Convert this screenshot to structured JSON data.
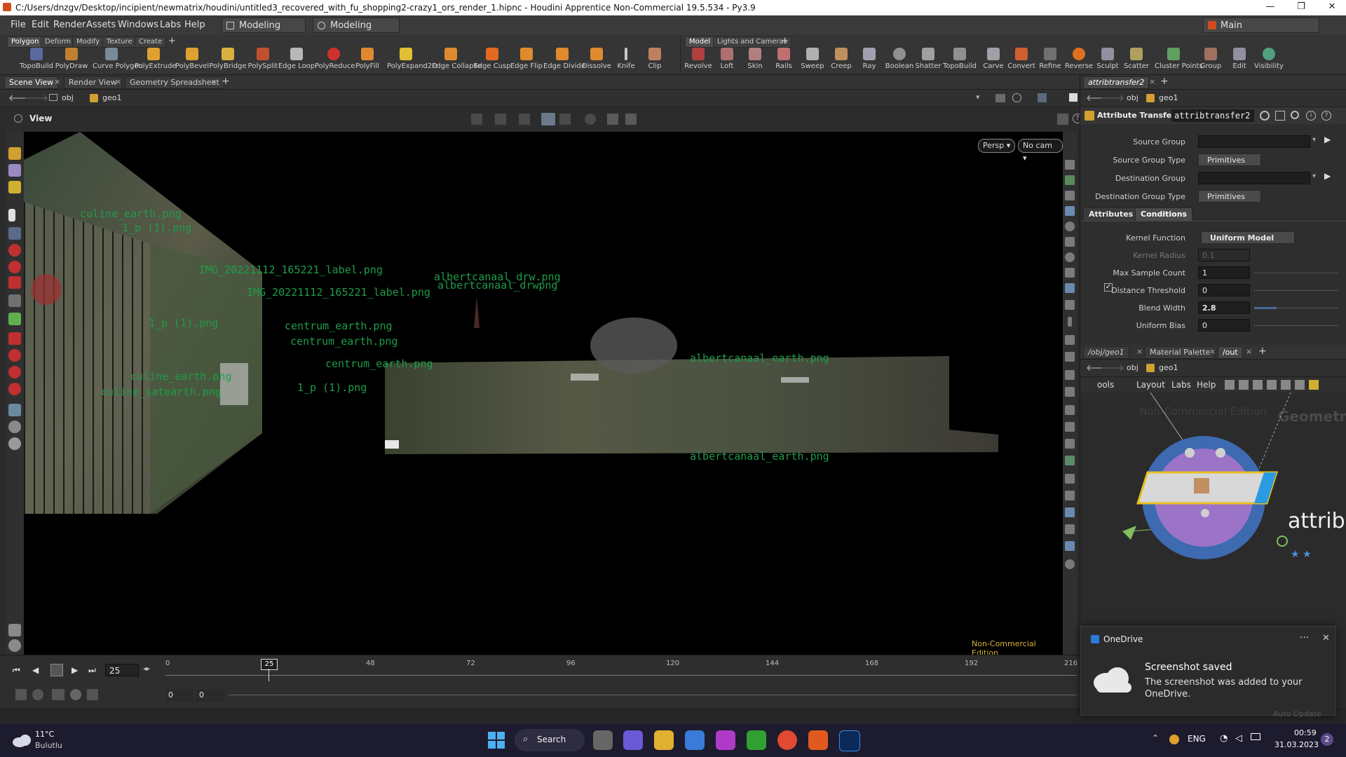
{
  "window": {
    "title": "C:/Users/dnzgv/Desktop/incipient/newmatrix/houdini/untitled3_recovered_with_fu_shopping2-crazy1_ors_render_1.hipnc - Houdini Apprentice Non-Commercial 19.5.534 - Py3.9",
    "minimize": "—",
    "maximize": "❐",
    "close": "✕"
  },
  "menubar": {
    "items": [
      "File",
      "Edit",
      "Render",
      "Assets",
      "Windows",
      "Labs",
      "Help"
    ],
    "desktop1": "Modeling",
    "desktop2": "Modeling",
    "desktop_main": "Main"
  },
  "shelf": {
    "tabs_left": [
      "Polygon",
      "Deform",
      "Modify",
      "Texture",
      "Create"
    ],
    "tabs_right": [
      "Model",
      "Lights and Cameras"
    ],
    "tools_left": [
      "TopoBuild",
      "PolyDraw",
      "Curve Polygon",
      "PolyExtrude",
      "PolyBevel",
      "PolyBridge",
      "PolySplit",
      "Edge Loop",
      "PolyReduce",
      "PolyFill",
      "PolyExpand2D",
      "Edge Collapse",
      "Edge Cusp",
      "Edge Flip",
      "Edge Divide",
      "Dissolve",
      "Knife",
      "Clip"
    ],
    "tools_right": [
      "Revolve",
      "Loft",
      "Skin",
      "Rails",
      "Sweep",
      "Creep",
      "Ray",
      "Boolean",
      "Shatter",
      "TopoBuild",
      "Carve",
      "Convert",
      "Refine",
      "Reverse",
      "Sculpt",
      "Scatter",
      "Cluster Points",
      "Group",
      "Edit",
      "Visibility"
    ]
  },
  "scene_pane": {
    "tabs": [
      "Scene View",
      "Render View",
      "Geometry Spreadsheet"
    ],
    "path_obj": "obj",
    "path_geo": "geo1",
    "view_label": "View",
    "persp": "Persp ▾",
    "cam": "No cam ▾",
    "watermark": "Non-Commercial Edition",
    "texture_labels": [
      "culine_earth.png",
      "1_p (1).png",
      "IMG_20221112_165221_label.png",
      "IMG_20221112_165221_label.png",
      "albertcanaal_drw.png",
      "albertcanaal_drwpng",
      "centrum_earth.png",
      "centrum_earth.png",
      "1_p (1).png",
      "centrum_earth.png",
      "1_p (1).png",
      "culine_earth.png",
      "culine_satearth.png",
      "albertcanaal_earth.png",
      "albertcanaal_earth.png"
    ]
  },
  "timeline": {
    "current_frame": "25",
    "marker": "25",
    "ticks": [
      "0",
      "48",
      "72",
      "96",
      "120",
      "144",
      "168",
      "192",
      "216"
    ],
    "start_field": "0",
    "end_field": "0"
  },
  "parm_pane": {
    "tab": "attribtransfer2",
    "path_obj": "obj",
    "path_geo": "geo1",
    "node_type": "Attribute Transfer",
    "node_name": "attribtransfer2",
    "source_group_label": "Source Group",
    "source_group_value": "",
    "source_group_type_label": "Source Group Type",
    "source_group_type_value": "Primitives",
    "dest_group_label": "Destination Group",
    "dest_group_value": "",
    "dest_group_type_label": "Destination Group Type",
    "dest_group_type_value": "Primitives",
    "subtabs": [
      "Attributes",
      "Conditions"
    ],
    "kernel_function_label": "Kernel Function",
    "kernel_function_value": "Uniform Model",
    "kernel_radius_label": "Kernel Radius",
    "kernel_radius_value": "0.1",
    "max_sample_label": "Max Sample Count",
    "max_sample_value": "1",
    "distance_threshold_label": "Distance Threshold",
    "distance_threshold_value": "0",
    "blend_width_label": "Blend Width",
    "blend_width_value": "2.8",
    "uniform_bias_label": "Uniform Bias",
    "uniform_bias_value": "0"
  },
  "network_pane": {
    "tabs": [
      "/obj/geo1",
      "Material Palette",
      "/out"
    ],
    "path_obj": "obj",
    "path_geo": "geo1",
    "menu": [
      "ools",
      "Layout",
      "Labs",
      "Help"
    ],
    "watermark": "Non-Commercial Edition",
    "context": "Geometry",
    "node_label": "attrib"
  },
  "toast": {
    "app": "OneDrive",
    "more": "···",
    "close": "✕",
    "title": "Screenshot saved",
    "body": "The screenshot was added to your OneDrive.",
    "behind": "Auto Update"
  },
  "taskbar": {
    "weather_temp": "11°C",
    "weather_desc": "Bulutlu",
    "search": "Search",
    "lang": "ENG",
    "time": "00:59",
    "date": "31.03.2023",
    "notif_count": "2"
  }
}
